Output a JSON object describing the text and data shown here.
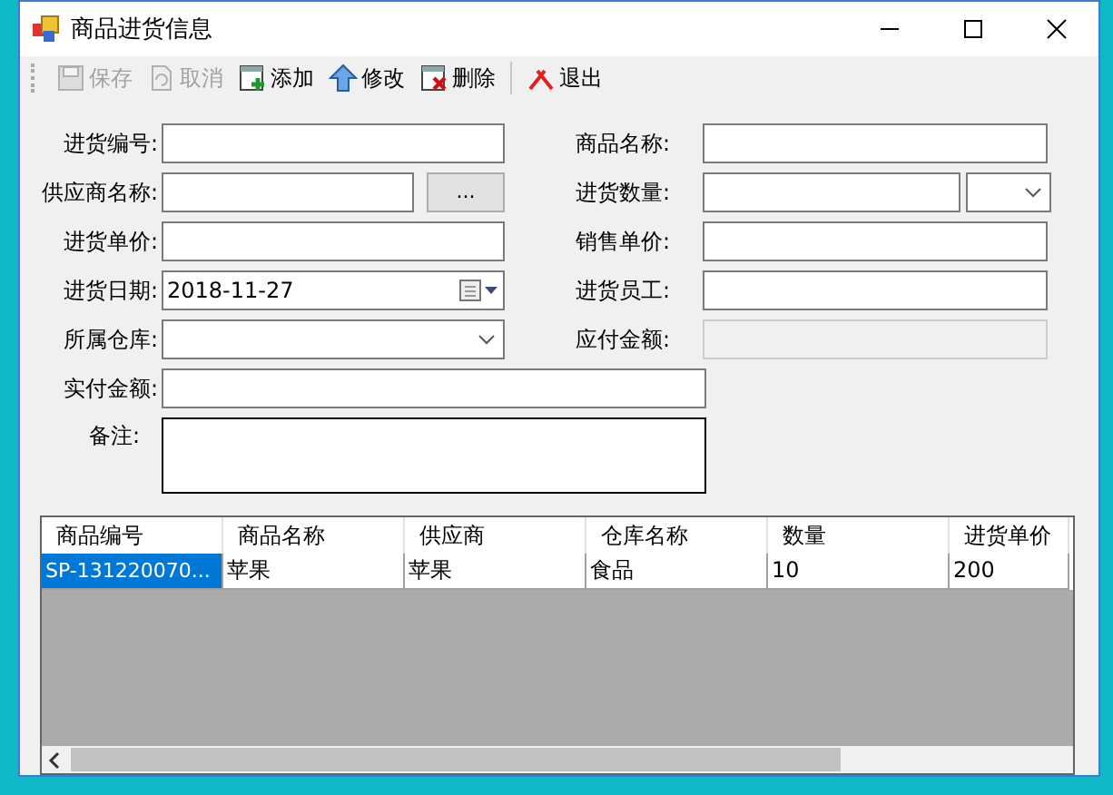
{
  "window": {
    "title": "商品进货信息"
  },
  "toolbar": [
    {
      "label": "保存",
      "kind": "save",
      "disabled": true
    },
    {
      "label": "取消",
      "kind": "cancel",
      "disabled": true
    },
    {
      "label": "添加",
      "kind": "add",
      "disabled": false
    },
    {
      "label": "修改",
      "kind": "edit",
      "disabled": false
    },
    {
      "label": "删除",
      "kind": "delete",
      "disabled": false
    },
    {
      "label": "退出",
      "kind": "exit",
      "disabled": false
    }
  ],
  "form_rows": [
    {
      "left": {
        "label": "进货编号:",
        "kind": "text",
        "disabled": false
      },
      "right": {
        "label": "商品名称:",
        "kind": "text",
        "disabled": false
      }
    },
    {
      "left": {
        "label": "供应商名称:",
        "kind": "text_with_button",
        "button_label": "...",
        "disabled": false
      },
      "right": {
        "label": "进货数量:",
        "kind": "text_with_combo",
        "disabled": false
      }
    },
    {
      "left": {
        "label": "进货单价:",
        "kind": "text",
        "disabled": false
      },
      "right": {
        "label": "销售单价:",
        "kind": "text",
        "disabled": false
      }
    },
    {
      "left": {
        "label": "进货日期:",
        "kind": "date",
        "value": "2018-11-27",
        "disabled": false
      },
      "right": {
        "label": "进货员工:",
        "kind": "text",
        "disabled": false
      }
    },
    {
      "left": {
        "label": "所属仓库:",
        "kind": "combo",
        "disabled": false
      },
      "right": {
        "label": "应付金额:",
        "kind": "text",
        "disabled": true
      }
    },
    {
      "left": {
        "label": "实付金额:",
        "kind": "wide_text",
        "disabled": false
      }
    },
    {
      "left": {
        "label": "备注:",
        "kind": "textarea",
        "disabled": false
      }
    }
  ],
  "table": {
    "columns": [
      "商品编号",
      "商品名称",
      "供应商",
      "仓库名称",
      "数量",
      "进货单价"
    ],
    "rows": [
      {
        "selected": true,
        "cells": [
          "SP-131220070...",
          "苹果",
          "苹果",
          "食品",
          "10",
          "200"
        ]
      }
    ]
  }
}
